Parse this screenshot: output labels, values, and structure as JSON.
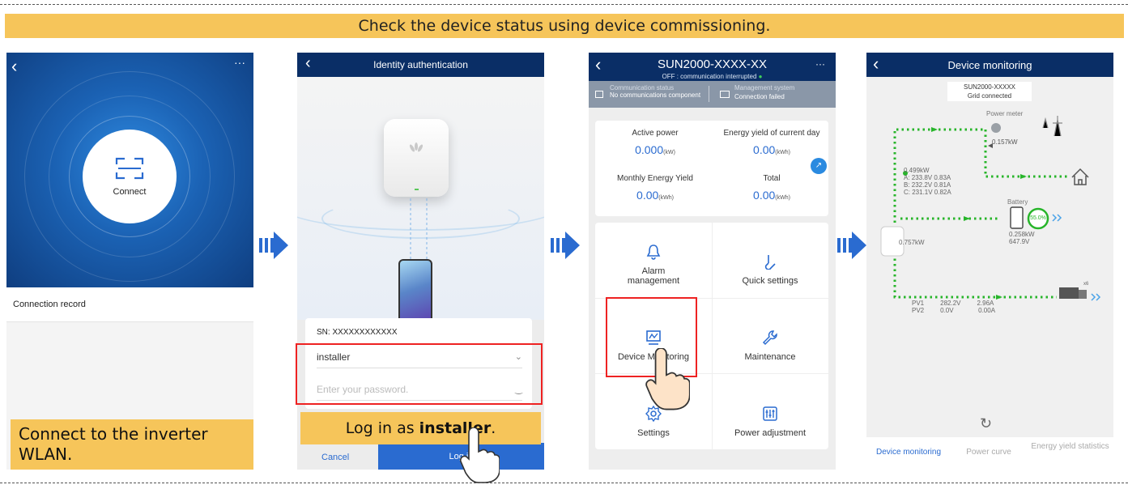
{
  "banner": "Check the device status using device commissioning.",
  "step1": {
    "connect_label": "Connect",
    "connection_record": "Connection record",
    "callout": "Connect to the inverter WLAN."
  },
  "step2": {
    "title": "Identity authentication",
    "sn": "SN: XXXXXXXXXXXX",
    "username": "installer",
    "password_placeholder": "Enter your password.",
    "callout_prefix": "Log in as ",
    "callout_bold": "installer",
    "callout_suffix": ".",
    "cancel": "Cancel",
    "login": "Log in"
  },
  "step3": {
    "title": "SUN2000-XXXX-XX",
    "subtitle": "OFF : communication interrupted",
    "comm_status_label": "Communication status",
    "comm_status_value": "No communications component",
    "mgmt_label": "Management system",
    "mgmt_value": "Connection failed",
    "stats": [
      {
        "label": "Active power",
        "value": "0.000",
        "unit": "(kW)"
      },
      {
        "label": "Energy yield of current day",
        "value": "0.00",
        "unit": "(kWh)"
      },
      {
        "label": "Monthly Energy Yield",
        "value": "0.00",
        "unit": "(kWh)"
      },
      {
        "label": "Total",
        "value": "0.00",
        "unit": "(kWh)"
      }
    ],
    "menu": [
      {
        "label": "Alarm management",
        "icon": "alarm-bell-icon"
      },
      {
        "label": "Quick settings",
        "icon": "quick-settings-icon"
      },
      {
        "label": "Device Monitoring",
        "icon": "device-monitoring-icon"
      },
      {
        "label": "Maintenance",
        "icon": "maintenance-wrench-icon"
      },
      {
        "label": "Settings",
        "icon": "settings-gear-icon"
      },
      {
        "label": "Power adjustment",
        "icon": "power-adjustment-icon"
      }
    ]
  },
  "step4": {
    "title": "Device monitoring",
    "device": "SUN2000-XXXXX",
    "device_status": "Grid connected",
    "power_meter": "Power meter",
    "meter_power": "0.157kW",
    "inverter_power": "0.499kW",
    "phase_a": "A: 233.8V 0.83A",
    "phase_b": "B: 232.2V 0.81A",
    "phase_c": "C: 231.1V 0.82A",
    "battery_label": "Battery",
    "battery_soc": "55.0%",
    "battery_power": "0.258kW",
    "battery_voltage": "647.9V",
    "pv_total": "0.757kW",
    "pv1": {
      "name": "PV1",
      "voltage": "282.2V",
      "current": "2.96A"
    },
    "pv2": {
      "name": "PV2",
      "voltage": "0.0V",
      "current": "0.00A"
    },
    "pv_count": "x6",
    "tabs": [
      "Device monitoring",
      "Power curve",
      "Energy yield statistics"
    ]
  },
  "colors": {
    "accent": "#2a6bd0",
    "header": "#0a2e66",
    "callout": "#f6c55a",
    "highlight": "#e22222",
    "flow": "#27b52a"
  }
}
